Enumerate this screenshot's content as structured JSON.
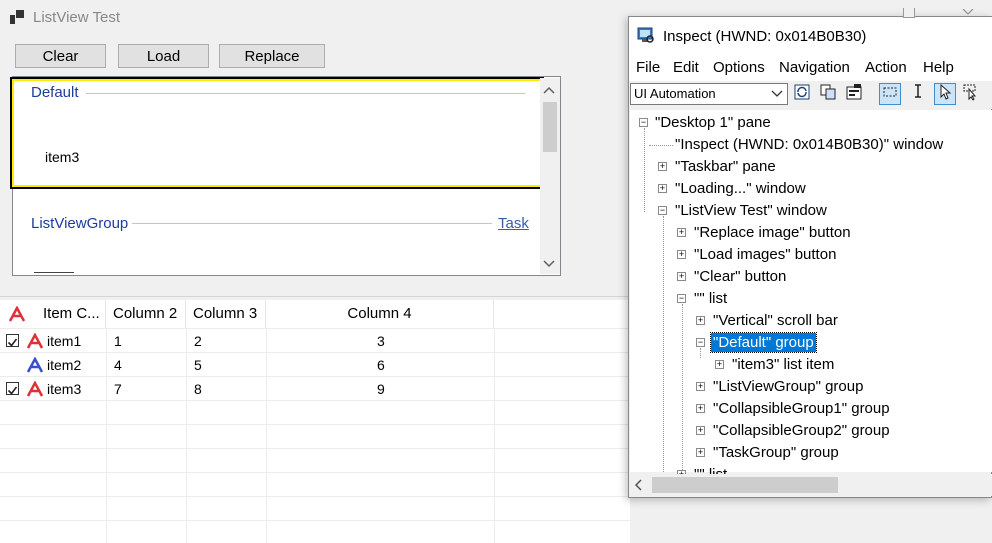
{
  "listview_window": {
    "title": "ListView Test",
    "buttons": {
      "clear": "Clear",
      "load": "Load",
      "replace": "Replace"
    },
    "groups": [
      {
        "header": "Default",
        "items": [
          "item3"
        ]
      },
      {
        "header": "ListViewGroup",
        "task": "Task"
      }
    ],
    "columns": [
      "Item C...",
      "Column 2",
      "Column 3",
      "Column 4"
    ],
    "rows": [
      {
        "name": "item1",
        "checked": true,
        "c2": "1",
        "c3": "2",
        "c4": "3"
      },
      {
        "name": "item2",
        "checked": false,
        "c2": "4",
        "c3": "5",
        "c4": "6"
      },
      {
        "name": "item3",
        "checked": true,
        "c2": "7",
        "c3": "8",
        "c4": "9"
      }
    ]
  },
  "inspect_window": {
    "title": "Inspect  (HWND: 0x014B0B30)",
    "menu": [
      "File",
      "Edit",
      "Options",
      "Navigation",
      "Action",
      "Help"
    ],
    "mode": "UI Automation",
    "tree": [
      "\"Desktop 1\" pane",
      "\"Inspect  (HWND: 0x014B0B30)\" window",
      "\"Taskbar\" pane",
      "\"Loading...\" window",
      "\"ListView Test\" window",
      "\"Replace image\" button",
      "\"Load images\" button",
      "\"Clear\" button",
      "\"\" list",
      "\"Vertical\" scroll bar",
      "\"Default\" group",
      "\"item3\" list item",
      "\"ListViewGroup\" group",
      "\"CollapsibleGroup1\" group",
      "\"CollapsibleGroup2\" group",
      "\"TaskGroup\" group",
      "\"\" list"
    ],
    "selected_index": 10
  },
  "colors": {
    "accent_red": "#e0303a",
    "accent_blue": "#3a4fd0",
    "selection": "#0078d7",
    "group_text": "#1e3b9e"
  }
}
